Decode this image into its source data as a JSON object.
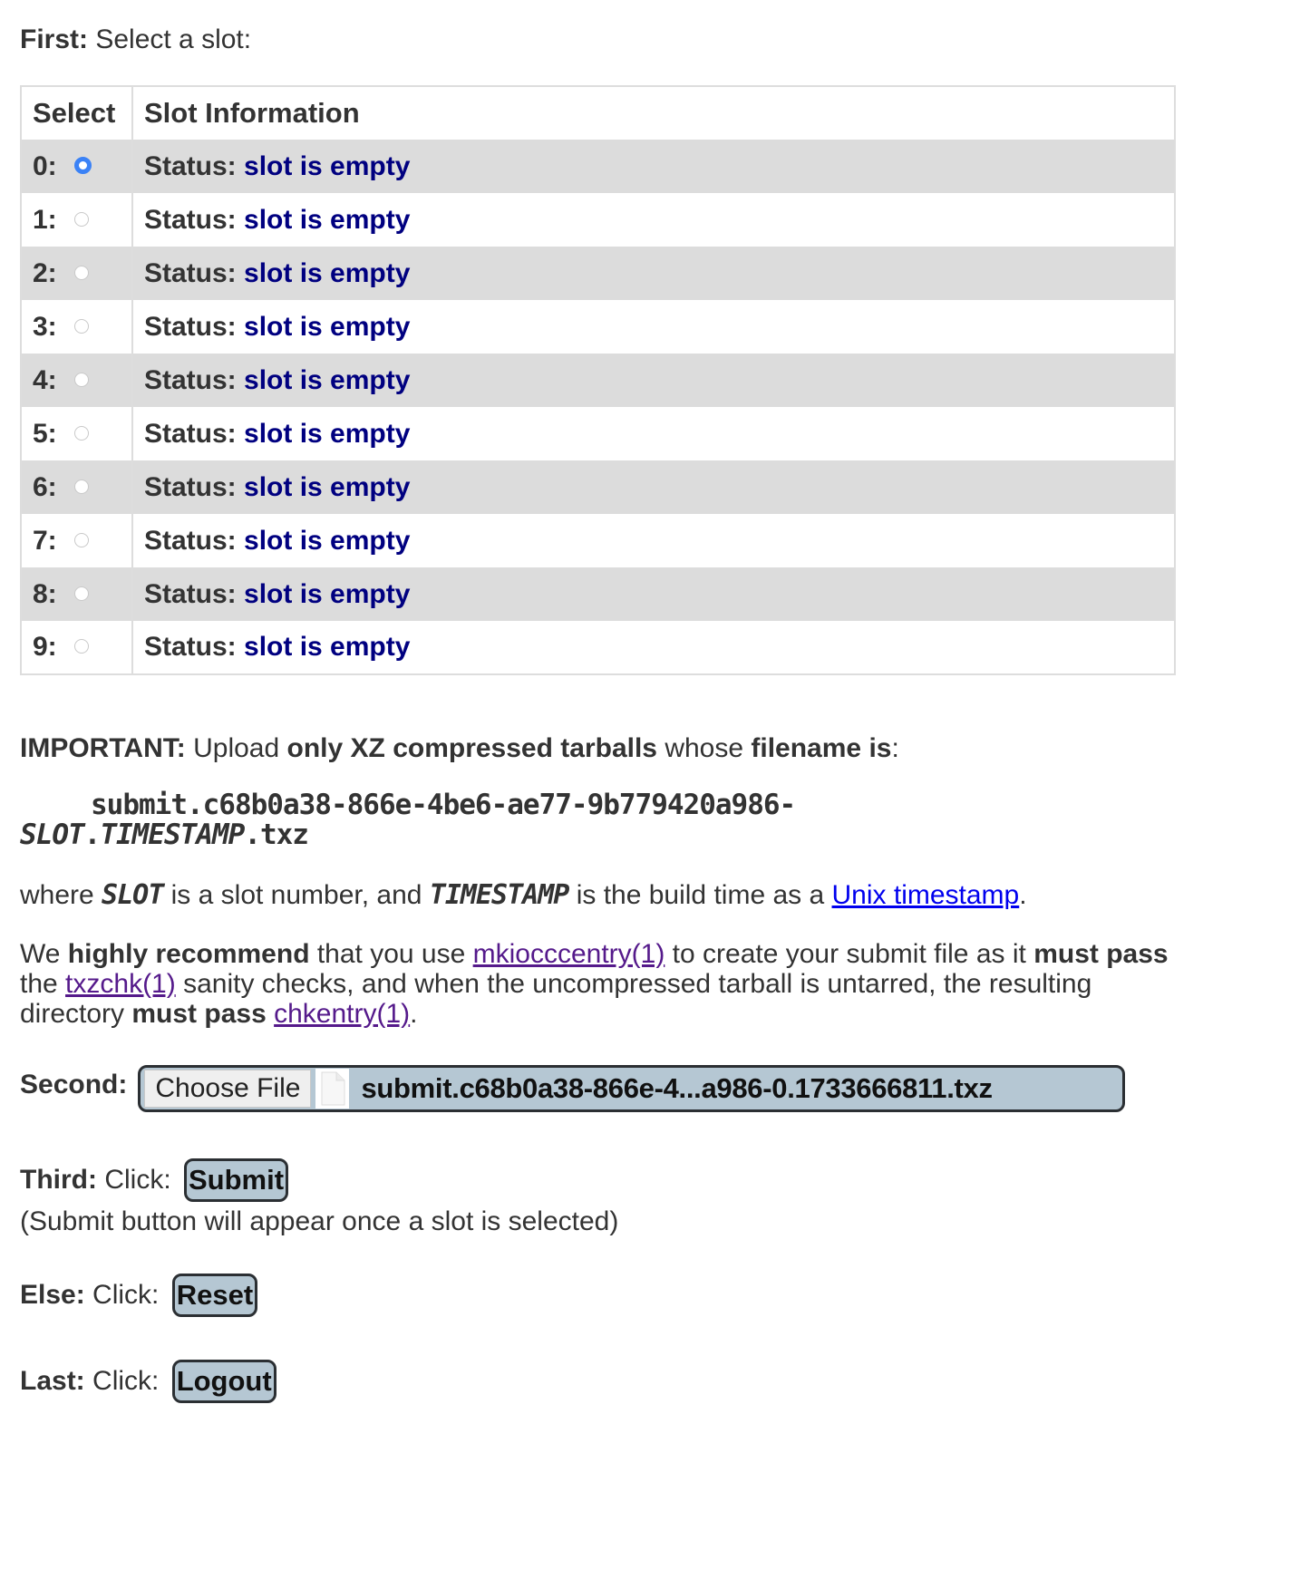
{
  "first": {
    "label": "First:",
    "text": " Select a slot:"
  },
  "table": {
    "headers": [
      "Select",
      "Slot Information"
    ],
    "status_label": "Status:",
    "selected_slot": 0,
    "rows": [
      {
        "slot": "0:",
        "status": "slot is empty"
      },
      {
        "slot": "1:",
        "status": "slot is empty"
      },
      {
        "slot": "2:",
        "status": "slot is empty"
      },
      {
        "slot": "3:",
        "status": "slot is empty"
      },
      {
        "slot": "4:",
        "status": "slot is empty"
      },
      {
        "slot": "5:",
        "status": "slot is empty"
      },
      {
        "slot": "6:",
        "status": "slot is empty"
      },
      {
        "slot": "7:",
        "status": "slot is empty"
      },
      {
        "slot": "8:",
        "status": "slot is empty"
      },
      {
        "slot": "9:",
        "status": "slot is empty"
      }
    ]
  },
  "important": {
    "label": "IMPORTANT:",
    "t1": " Upload ",
    "b1": "only XZ compressed tarballs",
    "t2": " whose ",
    "b2": "filename is",
    "t3": ":"
  },
  "filename_pattern": {
    "line1": "submit.c68b0a38-866e-4be6-ae77-9b779420a986-",
    "slot": "SLOT",
    "dot": ".",
    "timestamp": "TIMESTAMP",
    "ext": ".txz"
  },
  "where": {
    "t1": "where ",
    "slot": "SLOT",
    "t2": " is a slot number, and ",
    "timestamp": "TIMESTAMP",
    "t3": " is the build time as a ",
    "link": "Unix timestamp",
    "t4": "."
  },
  "recommend": {
    "t1": "We ",
    "b1": "highly recommend",
    "t2": " that you use ",
    "link1": "mkiocccentry(1)",
    "t3": " to create your submit file as it ",
    "b2": "must pass",
    "t4": " the ",
    "link2": "txzchk(1)",
    "t5": " sanity checks, and when the uncompressed tarball is untarred, the resulting directory ",
    "b3": "must pass",
    "t6": " ",
    "link3": "chkentry(1)",
    "t7": "."
  },
  "second": {
    "label": "Second:",
    "choose_button": "Choose File",
    "file_icon": "document-icon",
    "file_name": "submit.c68b0a38-866e-4...a986-0.1733666811.txz"
  },
  "third": {
    "label": "Third:",
    "text": " Click: ",
    "button": "Submit",
    "note": "(Submit button will appear once a slot is selected)"
  },
  "else": {
    "label": "Else:",
    "text": " Click: ",
    "button": "Reset"
  },
  "last": {
    "label": "Last:",
    "text": " Click: ",
    "button": "Logout"
  },
  "colors": {
    "status_value": "#000080",
    "row_stripe": "#dcdcdc",
    "button_bg": "#b5c7d3",
    "radio_checked": "#3b82f6",
    "link": "#0000ee",
    "visited_link": "#551a8b"
  }
}
